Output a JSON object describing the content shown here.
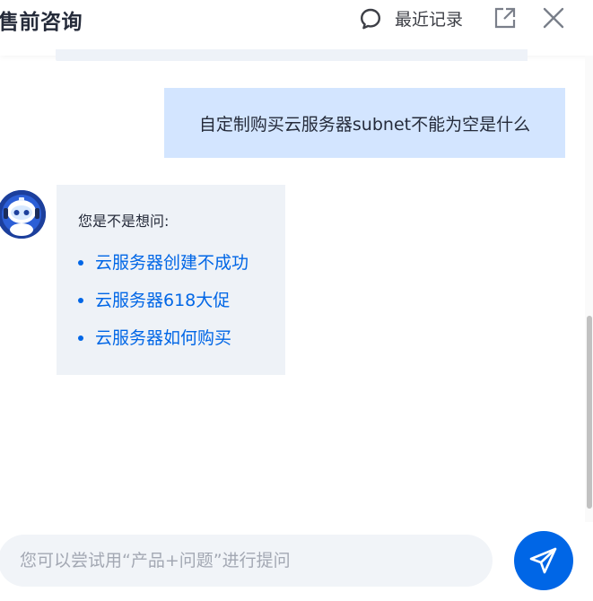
{
  "header": {
    "title": "售前咨询",
    "history_label": "最近记录",
    "icons": [
      "chat-bubble-icon",
      "external-link-icon",
      "close-icon"
    ]
  },
  "chat": {
    "user_message": "自定制购买云服务器subnet不能为空是什么",
    "bot": {
      "intro": "您是不是想问:",
      "suggestions": [
        "云服务器创建不成功",
        "云服务器618大促",
        "云服务器如何购买"
      ]
    }
  },
  "input": {
    "value": "",
    "placeholder": "您可以尝试用“产品+问题”进行提问"
  },
  "colors": {
    "accent": "#0066e6",
    "user_bubble": "#d3e5ff",
    "bot_bubble": "#eef2f7",
    "input_bg": "#f1f4f8",
    "avatar_bg": "#1c3f9c"
  }
}
